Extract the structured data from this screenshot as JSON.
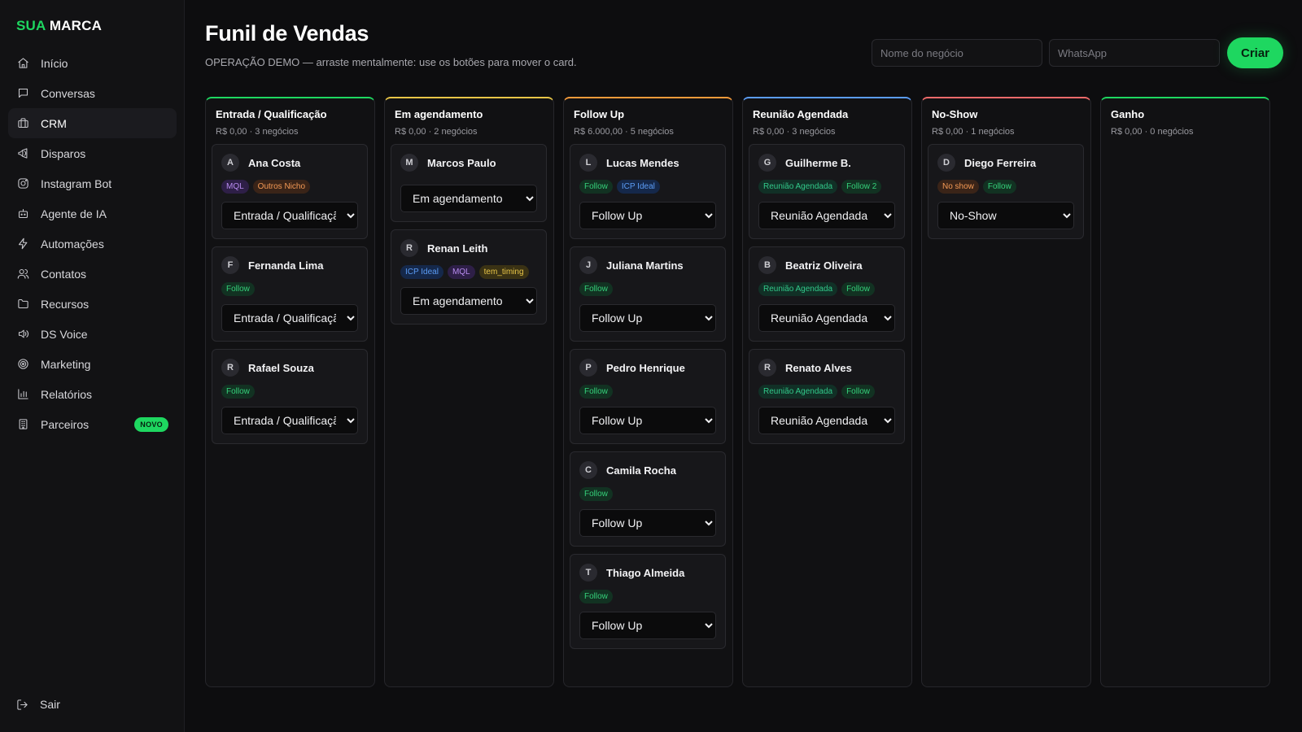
{
  "brand": {
    "accent": "SUA",
    "rest": "MARCA"
  },
  "sidebar": {
    "items": [
      {
        "label": "Início",
        "icon": "home-icon",
        "active": false
      },
      {
        "label": "Conversas",
        "icon": "chat-icon",
        "active": false
      },
      {
        "label": "CRM",
        "icon": "briefcase-icon",
        "active": true
      },
      {
        "label": "Disparos",
        "icon": "megaphone-icon",
        "active": false
      },
      {
        "label": "Instagram Bot",
        "icon": "instagram-icon",
        "active": false
      },
      {
        "label": "Agente de IA",
        "icon": "bot-icon",
        "active": false
      },
      {
        "label": "Automações",
        "icon": "bolt-icon",
        "active": false
      },
      {
        "label": "Contatos",
        "icon": "users-icon",
        "active": false
      },
      {
        "label": "Recursos",
        "icon": "folder-icon",
        "active": false
      },
      {
        "label": "DS Voice",
        "icon": "speaker-icon",
        "active": false
      },
      {
        "label": "Marketing",
        "icon": "target-icon",
        "active": false
      },
      {
        "label": "Relatórios",
        "icon": "bar-chart-icon",
        "active": false
      },
      {
        "label": "Parceiros",
        "icon": "building-icon",
        "active": false,
        "badge": "NOVO"
      }
    ],
    "logout_label": "Sair"
  },
  "header": {
    "title": "Funil de Vendas",
    "subtitle": "OPERAÇÃO DEMO — arraste mentalmente: use os botões para mover o card.",
    "deal_name_placeholder": "Nome do negócio",
    "whatsapp_placeholder": "WhatsApp",
    "create_label": "Criar"
  },
  "colors": {
    "accent": "#1ed760",
    "stage_entrada": "#1ed760",
    "stage_agendamento": "#e8c547",
    "stage_followup": "#f59a3a",
    "stage_reuniao": "#5b9cf5",
    "stage_noshow": "#f06a6a",
    "stage_ganho": "#1ed760"
  },
  "stage_options": [
    "Entrada / Qualificação",
    "Em agendamento",
    "Follow Up",
    "Reunião Agendada",
    "No-Show",
    "Ganho"
  ],
  "columns": [
    {
      "title": "Entrada / Qualificação",
      "meta": "R$ 0,00 · 3 negócios",
      "color_key": "stage_entrada",
      "cards": [
        {
          "initial": "A",
          "name": "Ana Costa",
          "tags": [
            {
              "label": "MQL",
              "style": "purple"
            },
            {
              "label": "Outros Nicho",
              "style": "orange"
            }
          ],
          "stage": "Entrada / Qualificação"
        },
        {
          "initial": "F",
          "name": "Fernanda Lima",
          "tags": [
            {
              "label": "Follow",
              "style": "green"
            }
          ],
          "stage": "Entrada / Qualificação"
        },
        {
          "initial": "R",
          "name": "Rafael Souza",
          "tags": [
            {
              "label": "Follow",
              "style": "green"
            }
          ],
          "stage": "Entrada / Qualificação"
        }
      ]
    },
    {
      "title": "Em agendamento",
      "meta": "R$ 0,00 · 2 negócios",
      "color_key": "stage_agendamento",
      "cards": [
        {
          "initial": "M",
          "name": "Marcos Paulo",
          "tags": [],
          "stage": "Em agendamento"
        },
        {
          "initial": "R",
          "name": "Renan Leith",
          "tags": [
            {
              "label": "ICP Ideal",
              "style": "blue"
            },
            {
              "label": "MQL",
              "style": "purple"
            },
            {
              "label": "tem_timing",
              "style": "yellow"
            }
          ],
          "stage": "Em agendamento"
        }
      ]
    },
    {
      "title": "Follow Up",
      "meta": "R$ 6.000,00 · 5 negócios",
      "color_key": "stage_followup",
      "cards": [
        {
          "initial": "L",
          "name": "Lucas Mendes",
          "tags": [
            {
              "label": "Follow",
              "style": "green"
            },
            {
              "label": "ICP Ideal",
              "style": "blue"
            }
          ],
          "stage": "Follow Up"
        },
        {
          "initial": "J",
          "name": "Juliana Martins",
          "tags": [
            {
              "label": "Follow",
              "style": "green"
            }
          ],
          "stage": "Follow Up"
        },
        {
          "initial": "P",
          "name": "Pedro Henrique",
          "tags": [
            {
              "label": "Follow",
              "style": "green"
            }
          ],
          "stage": "Follow Up"
        },
        {
          "initial": "C",
          "name": "Camila Rocha",
          "tags": [
            {
              "label": "Follow",
              "style": "green"
            }
          ],
          "stage": "Follow Up"
        },
        {
          "initial": "T",
          "name": "Thiago Almeida",
          "tags": [
            {
              "label": "Follow",
              "style": "green"
            }
          ],
          "stage": "Follow Up"
        }
      ]
    },
    {
      "title": "Reunião Agendada",
      "meta": "R$ 0,00 · 3 negócios",
      "color_key": "stage_reuniao",
      "cards": [
        {
          "initial": "G",
          "name": "Guilherme B.",
          "tags": [
            {
              "label": "Reunião Agendada",
              "style": "teal"
            },
            {
              "label": "Follow 2",
              "style": "green"
            }
          ],
          "stage": "Reunião Agendada"
        },
        {
          "initial": "B",
          "name": "Beatriz Oliveira",
          "tags": [
            {
              "label": "Reunião Agendada",
              "style": "teal"
            },
            {
              "label": "Follow",
              "style": "green"
            }
          ],
          "stage": "Reunião Agendada"
        },
        {
          "initial": "R",
          "name": "Renato Alves",
          "tags": [
            {
              "label": "Reunião Agendada",
              "style": "teal"
            },
            {
              "label": "Follow",
              "style": "green"
            }
          ],
          "stage": "Reunião Agendada"
        }
      ]
    },
    {
      "title": "No-Show",
      "meta": "R$ 0,00 · 1 negócios",
      "color_key": "stage_noshow",
      "cards": [
        {
          "initial": "D",
          "name": "Diego Ferreira",
          "tags": [
            {
              "label": "No show",
              "style": "orange"
            },
            {
              "label": "Follow",
              "style": "green"
            }
          ],
          "stage": "No-Show"
        }
      ]
    },
    {
      "title": "Ganho",
      "meta": "R$ 0,00 · 0 negócios",
      "color_key": "stage_ganho",
      "cards": []
    }
  ]
}
